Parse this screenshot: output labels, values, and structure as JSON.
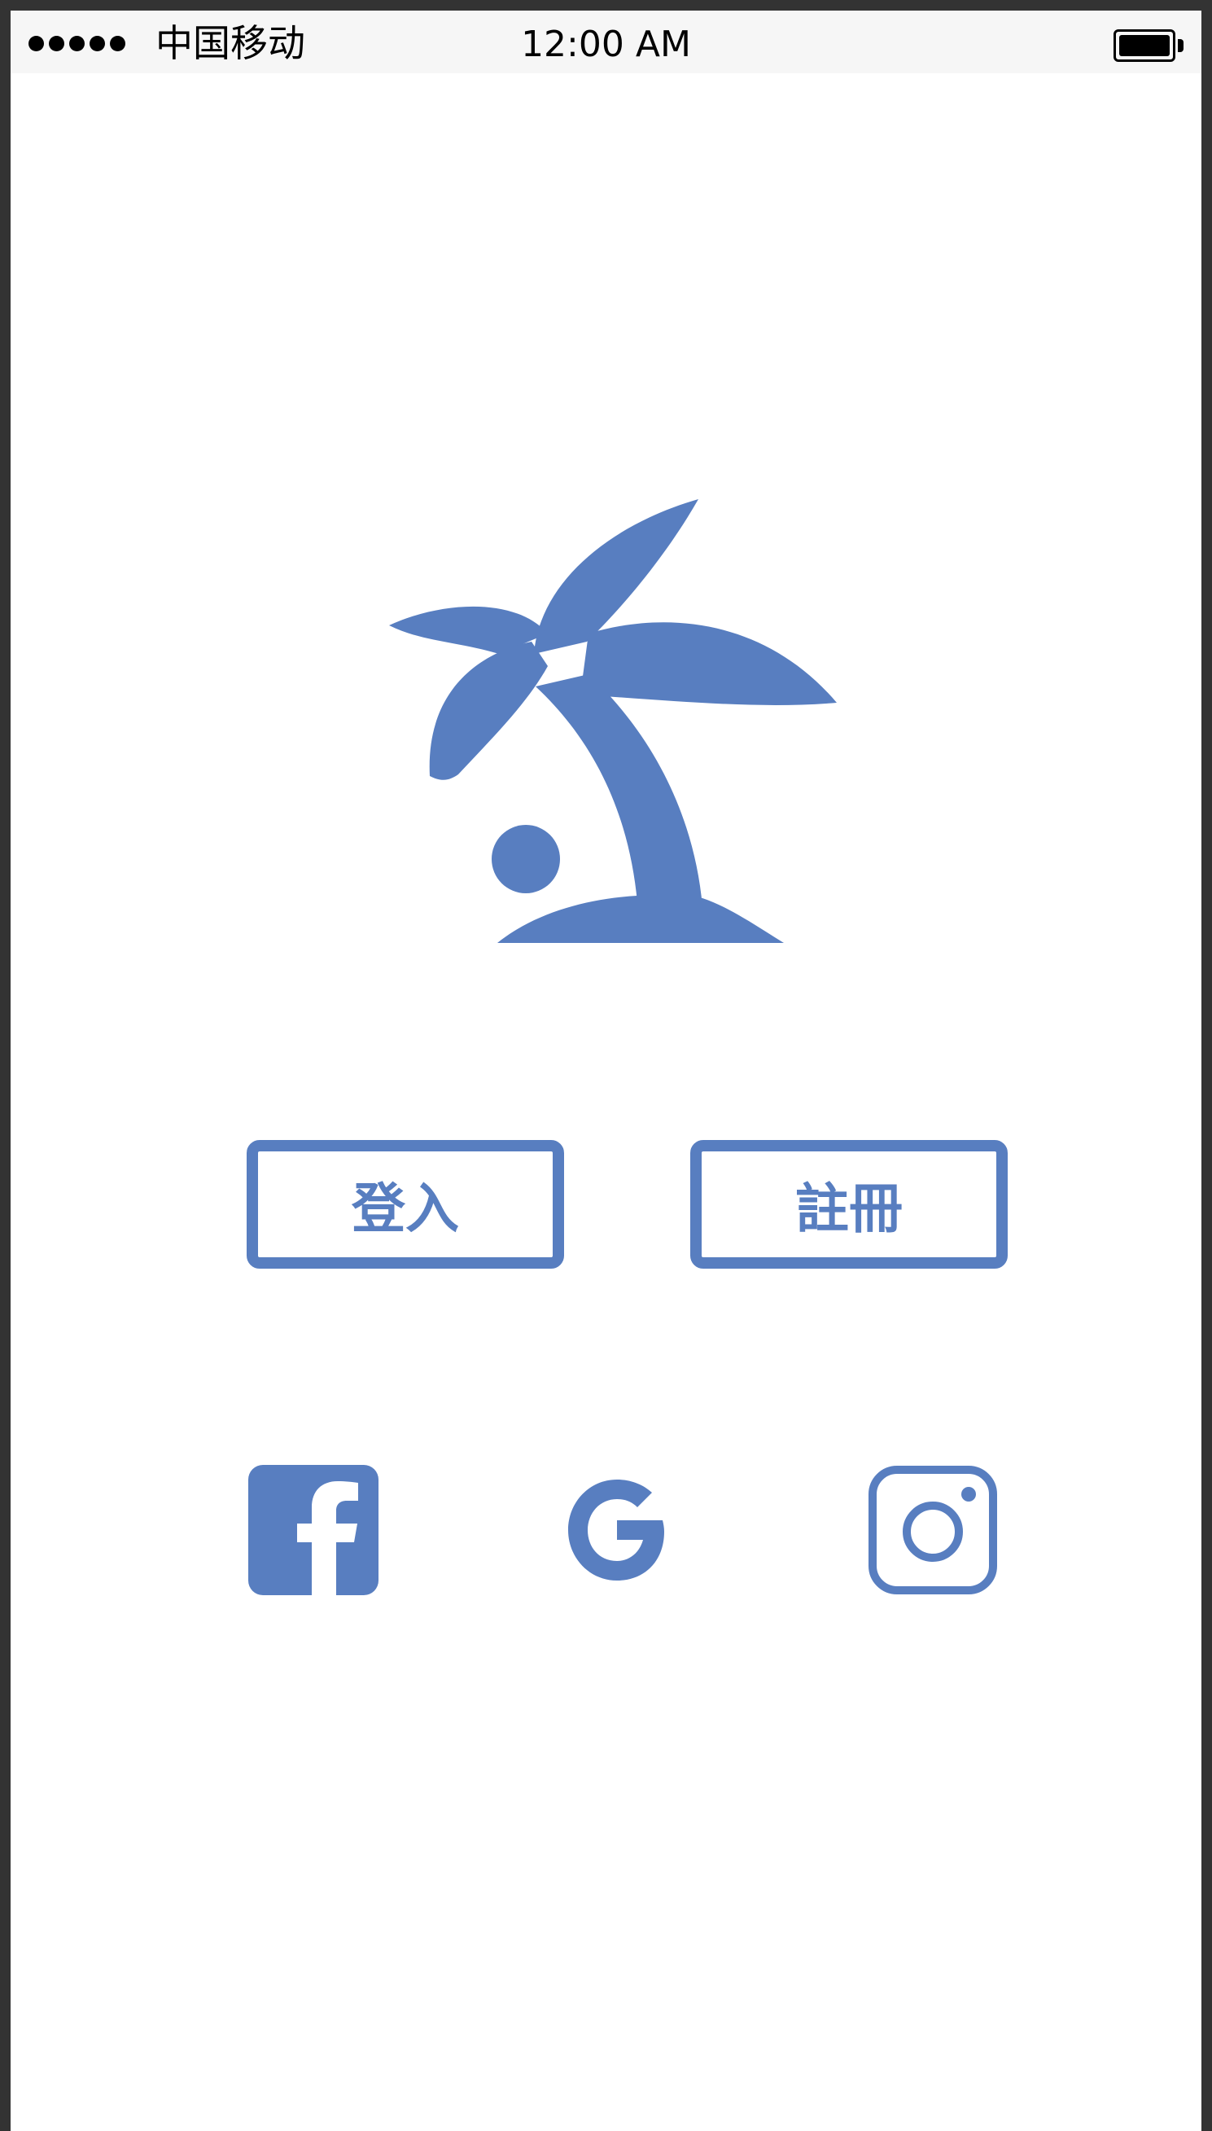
{
  "status_bar": {
    "carrier": "中国移动",
    "time": "12:00 AM",
    "signal_icon": "signal-dots-icon",
    "battery_icon": "battery-full-icon",
    "battery_level": 1.0
  },
  "logo": {
    "icon": "palm-tree-island-icon",
    "color": "#587ec0"
  },
  "auth": {
    "login_label": "登入",
    "register_label": "註冊"
  },
  "social": {
    "facebook_icon": "facebook-icon",
    "google_icon": "google-icon",
    "instagram_icon": "instagram-icon"
  },
  "colors": {
    "accent": "#587ec0",
    "status_bar_bg": "#f6f6f6",
    "frame": "#333333"
  }
}
